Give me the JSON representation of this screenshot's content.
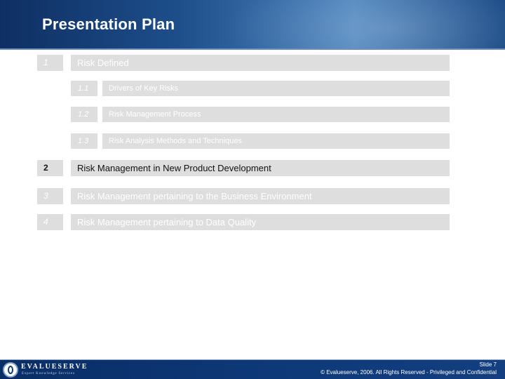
{
  "header": {
    "title": "Presentation Plan"
  },
  "agenda": [
    {
      "number": "1",
      "label": "Risk Defined",
      "active": false,
      "subitems": [
        {
          "number": "1.1",
          "label": "Drivers of Key Risks"
        },
        {
          "number": "1.2",
          "label": "Risk Management Process"
        },
        {
          "number": "1.3",
          "label": "Risk Analysis Methods and Techniques"
        }
      ]
    },
    {
      "number": "2",
      "label": "Risk Management in New Product Development",
      "active": true
    },
    {
      "number": "3",
      "label": "Risk Management pertaining to the Business Environment",
      "active": false
    },
    {
      "number": "4",
      "label": "Risk Management pertaining to Data Quality",
      "active": false
    }
  ],
  "footer": {
    "brand": "EVALUESERVE",
    "tagline": "Expert Knowledge Services",
    "slide": "Slide 7",
    "copyright": "© Evalueserve, 2006. All Rights Reserved - Privileged and Confidential"
  }
}
